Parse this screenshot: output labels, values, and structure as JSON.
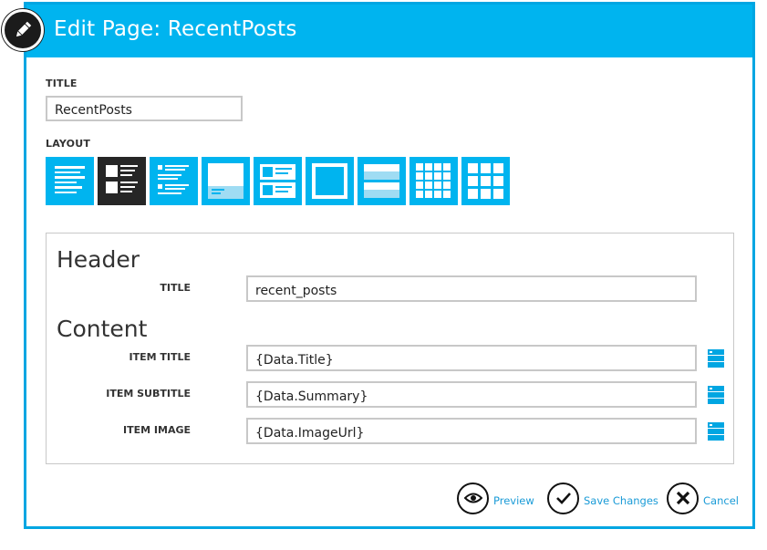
{
  "dialog": {
    "title": "Edit Page: RecentPosts"
  },
  "form": {
    "title_label": "TITLE",
    "title_value": "RecentPosts",
    "layout_label": "LAYOUT",
    "layouts": [
      {
        "icon": "list-layout-icon",
        "selected": false
      },
      {
        "icon": "image-list-layout-icon",
        "selected": true
      },
      {
        "icon": "compact-list-layout-icon",
        "selected": false
      },
      {
        "icon": "hero-layout-icon",
        "selected": false
      },
      {
        "icon": "thumbnail-list-layout-icon",
        "selected": false
      },
      {
        "icon": "single-item-layout-icon",
        "selected": false
      },
      {
        "icon": "banner-list-layout-icon",
        "selected": false
      },
      {
        "icon": "small-grid-layout-icon",
        "selected": false
      },
      {
        "icon": "large-grid-layout-icon",
        "selected": false
      }
    ]
  },
  "panel": {
    "header_heading": "Header",
    "header_title_label": "TITLE",
    "header_title_value": "recent_posts",
    "content_heading": "Content",
    "item_title_label": "ITEM TITLE",
    "item_title_value": "{Data.Title}",
    "item_subtitle_label": "ITEM SUBTITLE",
    "item_subtitle_value": "{Data.Summary}",
    "item_image_label": "ITEM IMAGE",
    "item_image_value": "{Data.ImageUrl}"
  },
  "actions": {
    "preview_label": "Preview",
    "save_label": "Save Changes",
    "cancel_label": "Cancel"
  },
  "colors": {
    "accent": "#00b4ef",
    "link": "#1a9bd7",
    "selected_tile": "#262626"
  }
}
